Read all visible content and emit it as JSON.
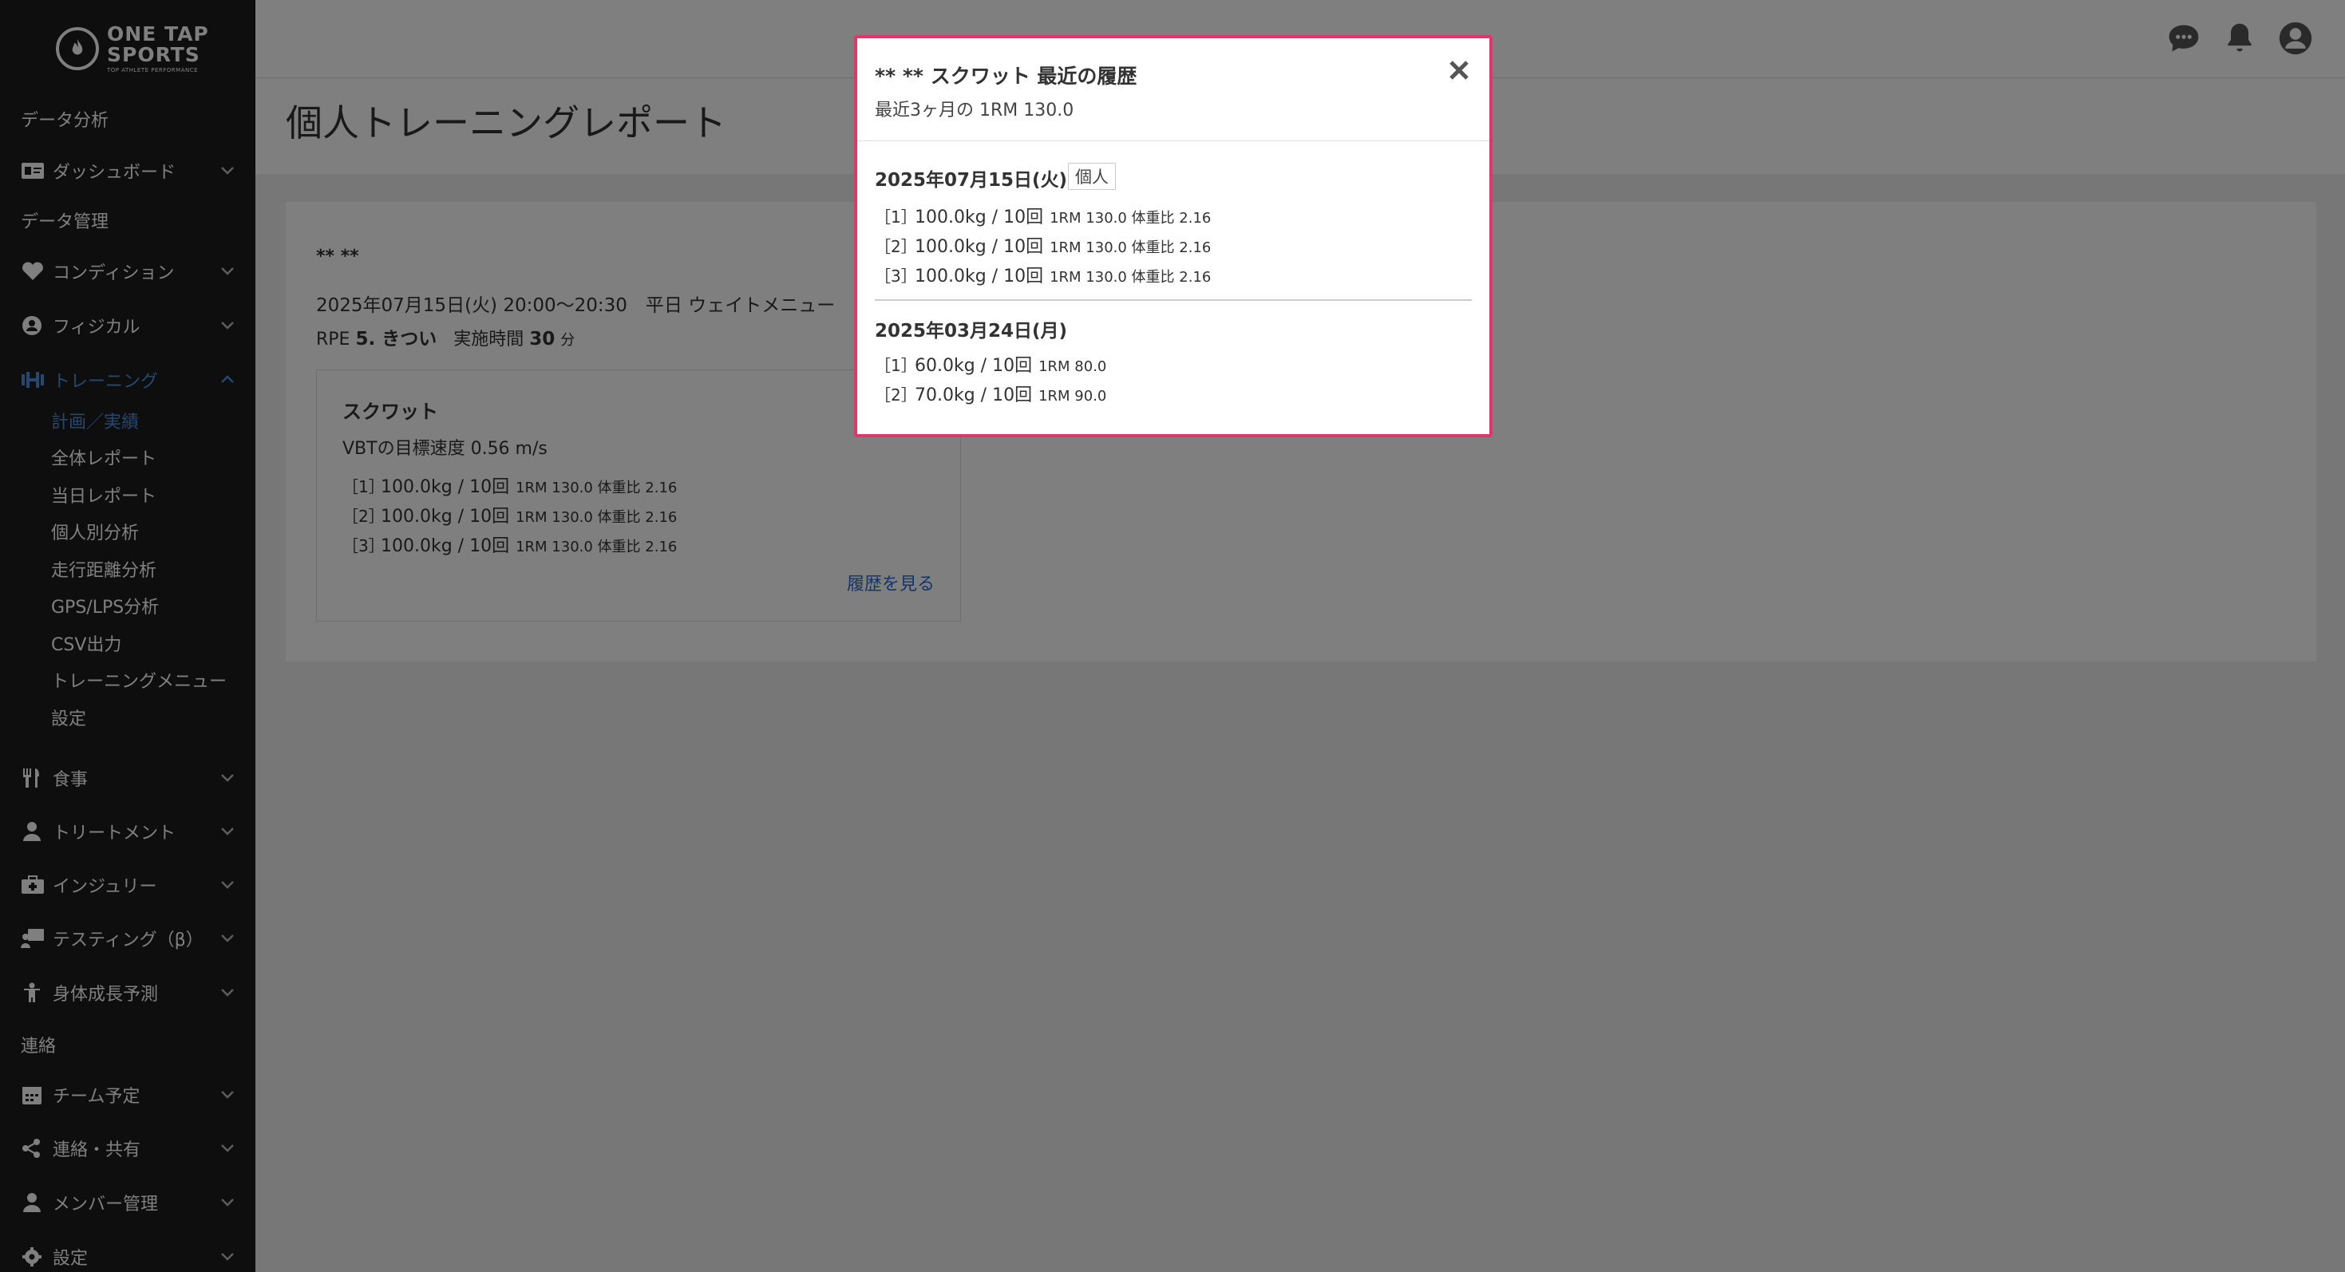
{
  "brand": {
    "line1": "ONE TAP",
    "line2": "SPORTS",
    "line3": "TOP ATHLETE PERFORMANCE"
  },
  "sidebar": {
    "section_analysis": "データ分析",
    "dashboard": "ダッシュボード",
    "section_data": "データ管理",
    "condition": "コンディション",
    "physical": "フィジカル",
    "training": "トレーニング",
    "training_sub": [
      "計画／実績",
      "全体レポート",
      "当日レポート",
      "個人別分析",
      "走行距離分析",
      "GPS/LPS分析",
      "CSV出力",
      "トレーニングメニュー",
      "設定"
    ],
    "meal": "食事",
    "treatment": "トリートメント",
    "injury": "インジュリー",
    "testing": "テスティング（β）",
    "growth": "身体成長予測",
    "section_contact": "連絡",
    "team_schedule": "チーム予定",
    "share": "連絡・共有",
    "members": "メンバー管理",
    "settings": "設定"
  },
  "page": {
    "title": "個人トレーニングレポート",
    "athlete": "** **",
    "session": "2025年07月15日(火) 20:00〜20:30　平日 ウェイトメニュー",
    "rpe_label": "RPE",
    "rpe_value": "5. きつい",
    "duration_label": "実施時間",
    "duration_value": "30",
    "duration_unit": "分"
  },
  "exercise": {
    "name": "スクワット",
    "vbt": "VBTの目標速度 0.56 m/s",
    "sets": [
      {
        "idx": "［1］",
        "main": "100.0kg / 10回",
        "meta": "1RM 130.0 体重比 2.16"
      },
      {
        "idx": "［2］",
        "main": "100.0kg / 10回",
        "meta": "1RM 130.0 体重比 2.16"
      },
      {
        "idx": "［3］",
        "main": "100.0kg / 10回",
        "meta": "1RM 130.0 体重比 2.16"
      }
    ],
    "history_link": "履歴を見る"
  },
  "modal": {
    "title": "** ** スクワット 最近の履歴",
    "subtitle": "最近3ヶ月の 1RM 130.0",
    "entries": [
      {
        "date": "2025年07月15日(火)",
        "badge": "個人",
        "sets": [
          {
            "idx": "［1］",
            "main": "100.0kg / 10回",
            "meta": "1RM 130.0 体重比 2.16"
          },
          {
            "idx": "［2］",
            "main": "100.0kg / 10回",
            "meta": "1RM 130.0 体重比 2.16"
          },
          {
            "idx": "［3］",
            "main": "100.0kg / 10回",
            "meta": "1RM 130.0 体重比 2.16"
          }
        ]
      },
      {
        "date": "2025年03月24日(月)",
        "sets": [
          {
            "idx": "［1］",
            "main": "60.0kg / 10回",
            "meta": "1RM 80.0"
          },
          {
            "idx": "［2］",
            "main": "70.0kg / 10回",
            "meta": "1RM 90.0"
          }
        ]
      }
    ]
  }
}
